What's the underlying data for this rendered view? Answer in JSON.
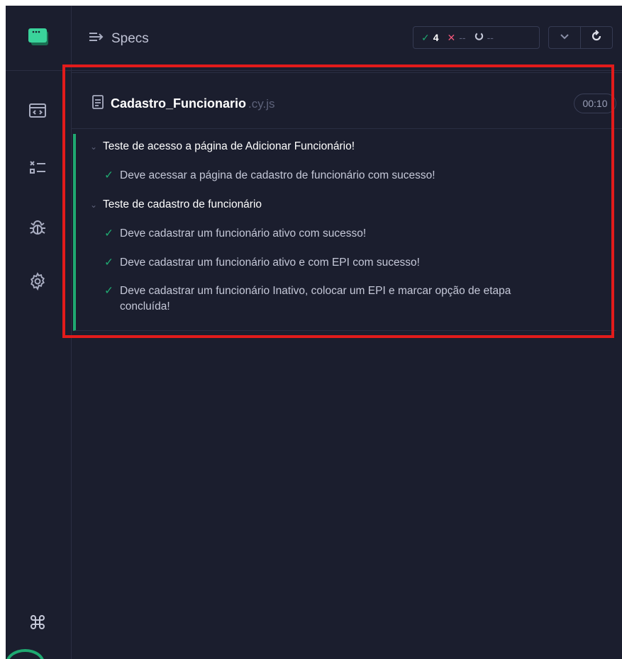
{
  "header": {
    "title": "Specs",
    "passed_count": "4",
    "failed_count": "--",
    "pending_count": "--"
  },
  "spec": {
    "name": "Cadastro_Funcionario",
    "extension": ".cy.js",
    "duration": "00:10"
  },
  "suites": [
    {
      "title": "Teste de acesso a página de Adicionar Funcionário!",
      "tests": [
        {
          "title": "Deve acessar a página de cadastro de funcionário com sucesso!"
        }
      ]
    },
    {
      "title": "Teste de cadastro de funcionário",
      "tests": [
        {
          "title": "Deve cadastrar um funcionário ativo com sucesso!"
        },
        {
          "title": "Deve cadastrar um funcionário ativo e com EPI com sucesso!"
        },
        {
          "title_line1": "Deve cadastrar um funcionário Inativo, colocar um EPI e marcar opção de etapa",
          "title_line2": "concluída!"
        }
      ]
    }
  ],
  "colors": {
    "background": "#1b1e2e",
    "pass": "#1fa971",
    "fail": "#f0567a",
    "highlight": "#e21b1b"
  },
  "icons": {
    "logo": "cypress-logo-icon",
    "specs": "browser-code-icon",
    "runs": "test-list-icon",
    "debug": "bug-icon",
    "settings": "gear-icon",
    "shortcuts": "command-key-icon"
  }
}
